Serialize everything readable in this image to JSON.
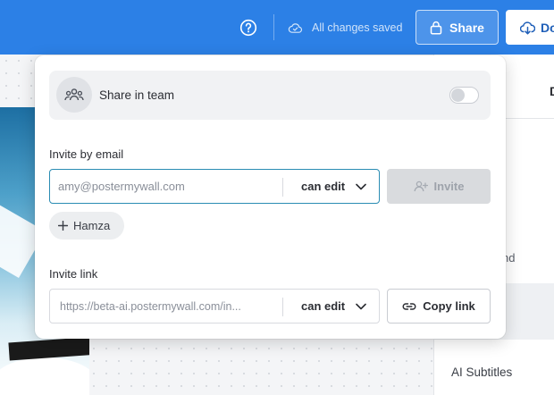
{
  "topbar": {
    "help_icon": "help-circle-icon",
    "save_status": "All changes saved",
    "share_label": "Share",
    "download_label": "Do",
    "colors": {
      "bar": "#2c80e6",
      "share_text": "#ffffff",
      "download_text": "#1f5fb8"
    }
  },
  "background": {
    "right_panel_heading": "D",
    "right_panel_fragment": "nd",
    "ai_subtitles_label": "AI Subtitles"
  },
  "share_popover": {
    "team": {
      "label": "Share in team",
      "icon": "users-group-icon",
      "enabled": false
    },
    "invite_by_email": {
      "label": "Invite by email",
      "email_placeholder": "amy@postermywall.com",
      "email_value": "",
      "permission": "can edit",
      "invite_label": "Invite",
      "invite_enabled": false,
      "chips": [
        {
          "label": "Hamza"
        }
      ]
    },
    "invite_link": {
      "label": "Invite link",
      "url": "https://beta-ai.postermywall.com/in...",
      "permission": "can edit",
      "copy_label": "Copy link"
    },
    "colors": {
      "focus_border": "#2a8cb3",
      "disabled_button": "#d9dbde"
    }
  }
}
